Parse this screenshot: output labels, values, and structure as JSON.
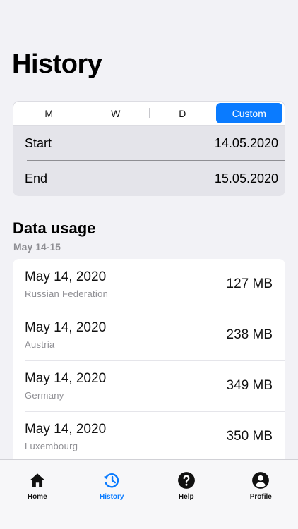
{
  "page": {
    "title": "History"
  },
  "range": {
    "segments": [
      "M",
      "W",
      "D",
      "Custom"
    ],
    "active_segment": "Custom",
    "start_label": "Start",
    "start_value": "14.05.2020",
    "end_label": "End",
    "end_value": "15.05.2020"
  },
  "usage": {
    "title": "Data usage",
    "subtitle": "May 14-15",
    "items": [
      {
        "date": "May 14, 2020",
        "country": "Russian Federation",
        "amount": "127 MB"
      },
      {
        "date": "May 14, 2020",
        "country": "Austria",
        "amount": "238 MB"
      },
      {
        "date": "May 14, 2020",
        "country": "Germany",
        "amount": "349 MB"
      },
      {
        "date": "May 14, 2020",
        "country": "Luxembourg",
        "amount": "350 MB"
      }
    ]
  },
  "tabbar": {
    "active": "History",
    "active_color": "#0a7bff",
    "tabs": [
      {
        "label": "Home",
        "icon": "home-icon"
      },
      {
        "label": "History",
        "icon": "history-icon"
      },
      {
        "label": "Help",
        "icon": "help-icon"
      },
      {
        "label": "Profile",
        "icon": "profile-icon"
      }
    ]
  }
}
